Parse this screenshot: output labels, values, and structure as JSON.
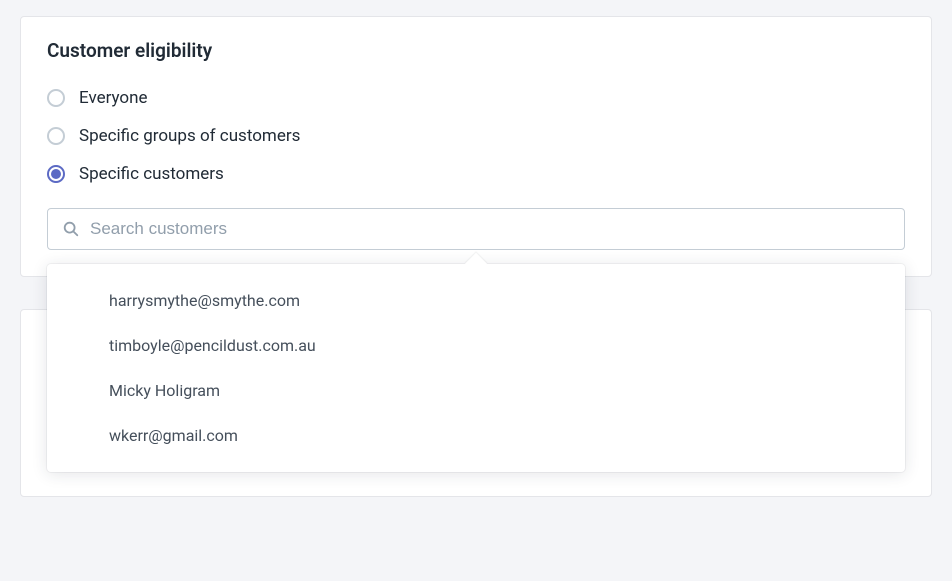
{
  "eligibility": {
    "title": "Customer eligibility",
    "options": {
      "everyone": "Everyone",
      "groups": "Specific groups of customers",
      "specific": "Specific customers"
    },
    "selected": "specific",
    "search": {
      "placeholder": "Search customers"
    },
    "suggestions": [
      "harrysmythe@smythe.com",
      "timboyle@pencildust.com.au",
      "Micky Holigram",
      "wkerr@gmail.com"
    ]
  }
}
